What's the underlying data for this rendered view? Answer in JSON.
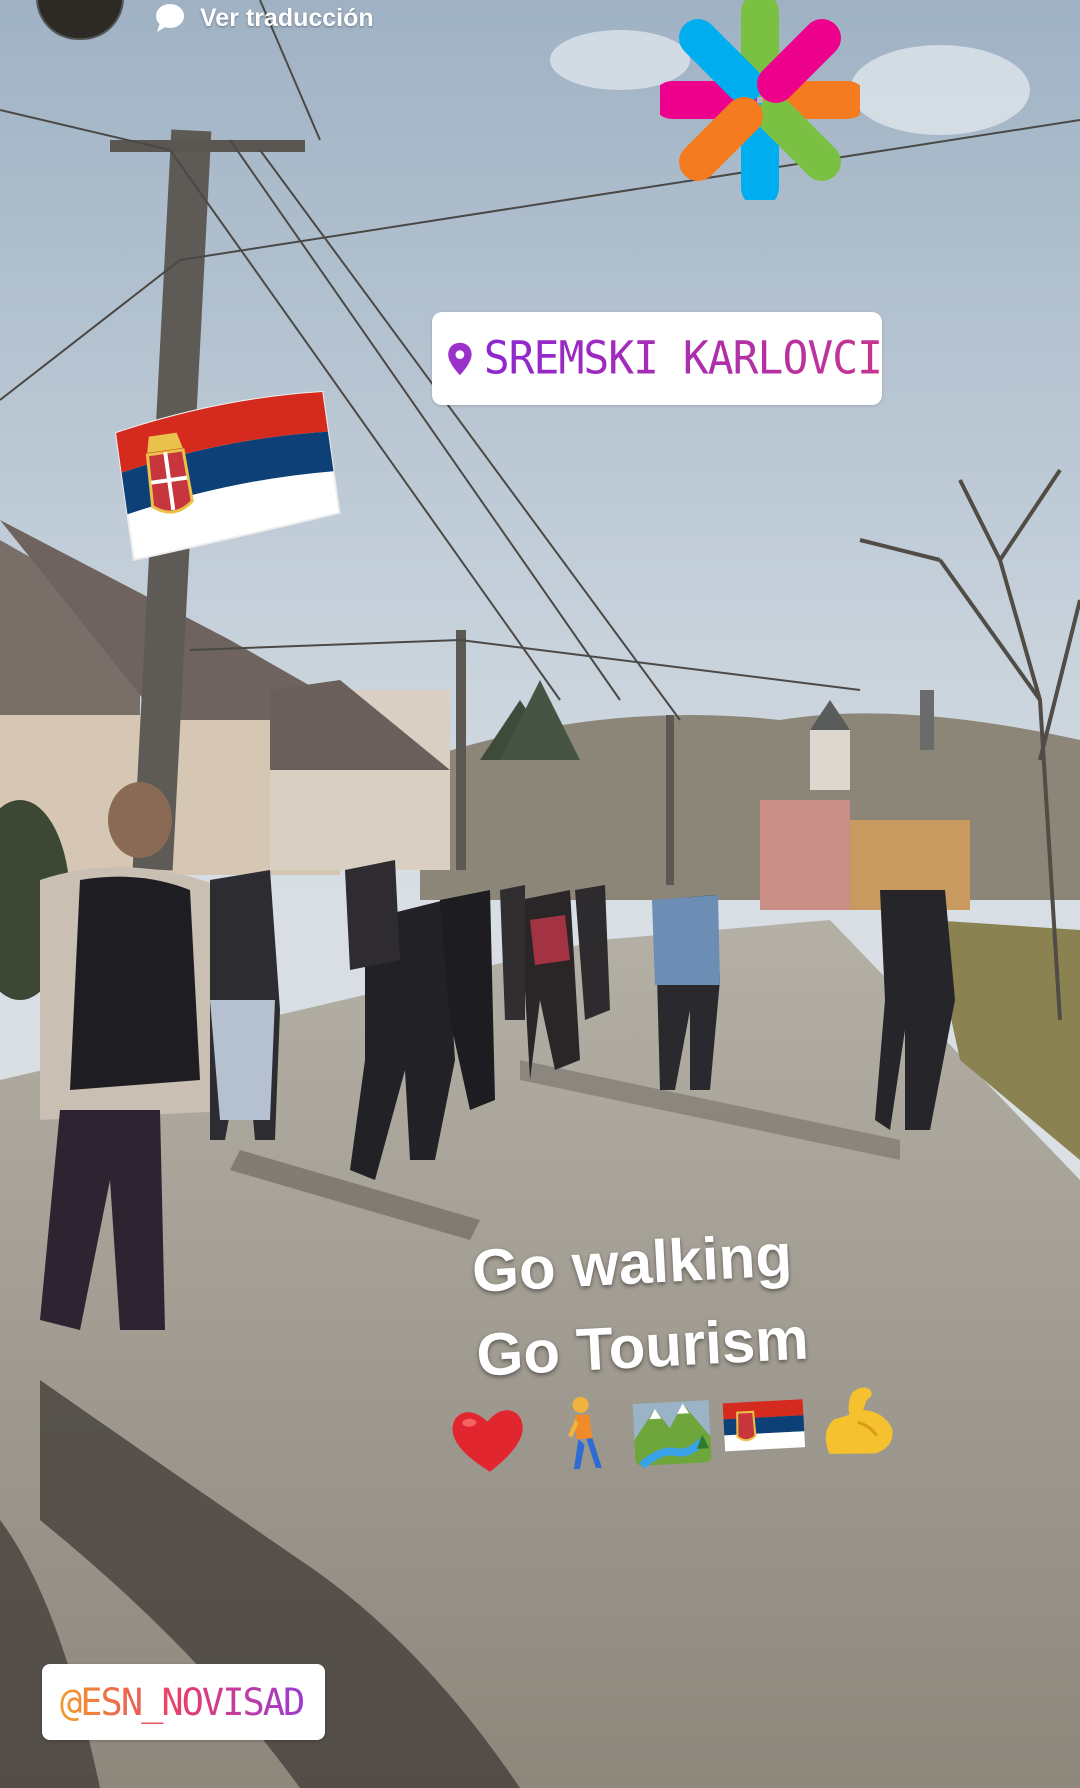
{
  "story": {
    "translate_label": "Ver traducción",
    "location_sticker": {
      "text": "SREMSKI KARLOVCI",
      "color": "#9a31c9",
      "icon": "location-pin-icon"
    },
    "caption": {
      "line1": "Go walking",
      "line2": "Go Tourism"
    },
    "emojis": [
      "heart-emoji",
      "walking-person-emoji",
      "mountain-river-emoji",
      "serbia-flag-emoji",
      "flexed-biceps-emoji"
    ],
    "mention_sticker": {
      "text": "@ESN_NOVISAD"
    },
    "flag_sticker": {
      "name": "serbia-flag-sticker",
      "colors": [
        "#d52b1e",
        "#0c4076",
        "#ffffff"
      ]
    },
    "brand_sticker": {
      "name": "esn-star-logo",
      "colors": [
        "#ec008c",
        "#7ac143",
        "#00aeef",
        "#f47b20"
      ]
    }
  }
}
